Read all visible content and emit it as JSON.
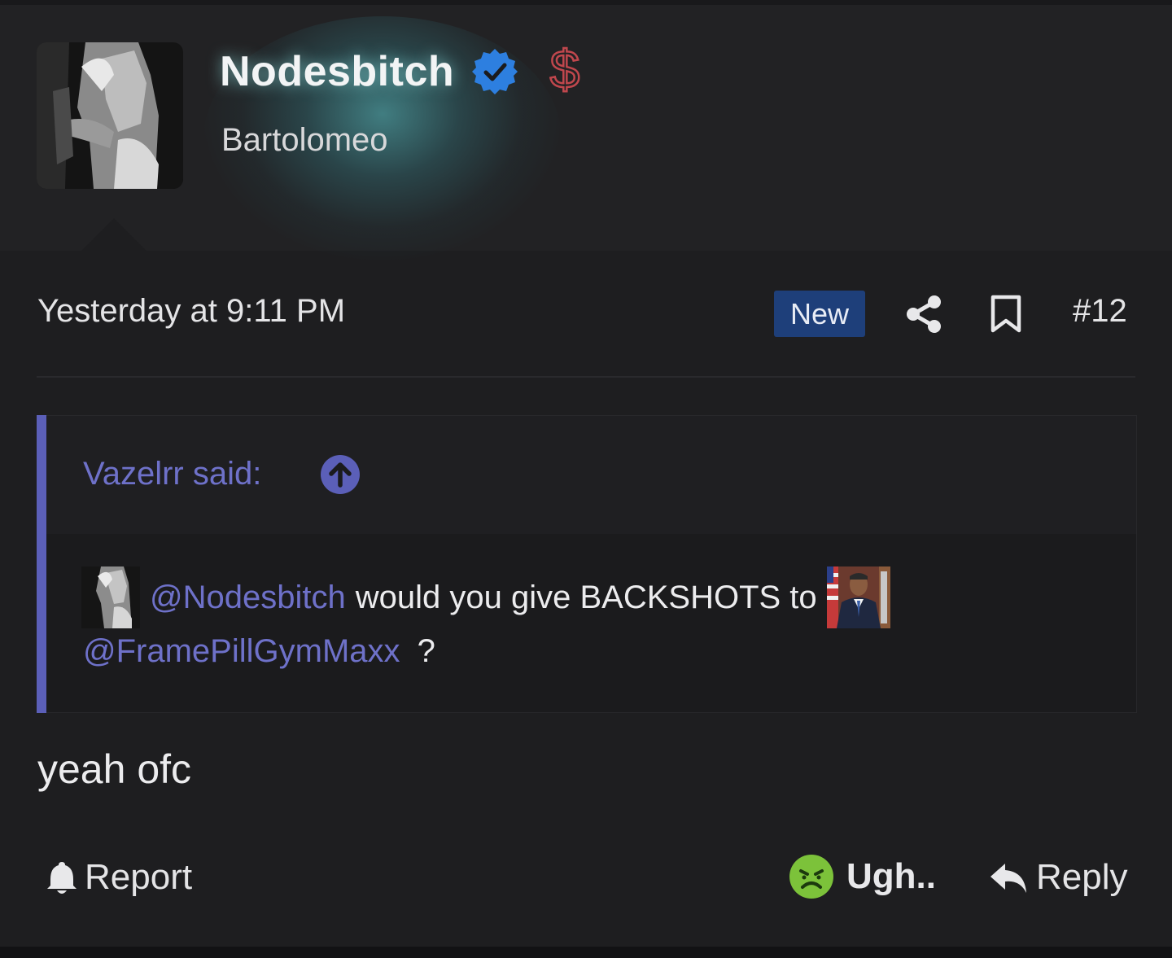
{
  "post": {
    "author": {
      "username": "Nodesbitch",
      "title": "Bartolomeo",
      "verified": true
    },
    "timestamp": "Yesterday at 9:11 PM",
    "badge": "New",
    "number": "#12",
    "quote": {
      "author_label": "Vazelrr said:",
      "mention_1": "@Nodesbitch",
      "text_1": "would you give BACKSHOTS to",
      "mention_2": "@FramePillGymMaxx",
      "text_2": "?"
    },
    "body": "yeah ofc"
  },
  "actions": {
    "report_label": "Report",
    "reaction_label": "Ugh..",
    "reply_label": "Reply"
  },
  "colors": {
    "background": "#1e1e20",
    "accent_link": "#6e71c9",
    "quote_bar": "#5b5fb8",
    "badge_bg": "#1e3f7a",
    "verified": "#2d7fe0",
    "dollar": "#c0474d",
    "reaction_icon": "#7cc23a"
  },
  "icons": [
    "verified-icon",
    "dollar-icon",
    "share-icon",
    "bookmark-icon",
    "arrow-up-icon",
    "bell-icon",
    "sick-face-icon",
    "reply-arrow-icon"
  ]
}
